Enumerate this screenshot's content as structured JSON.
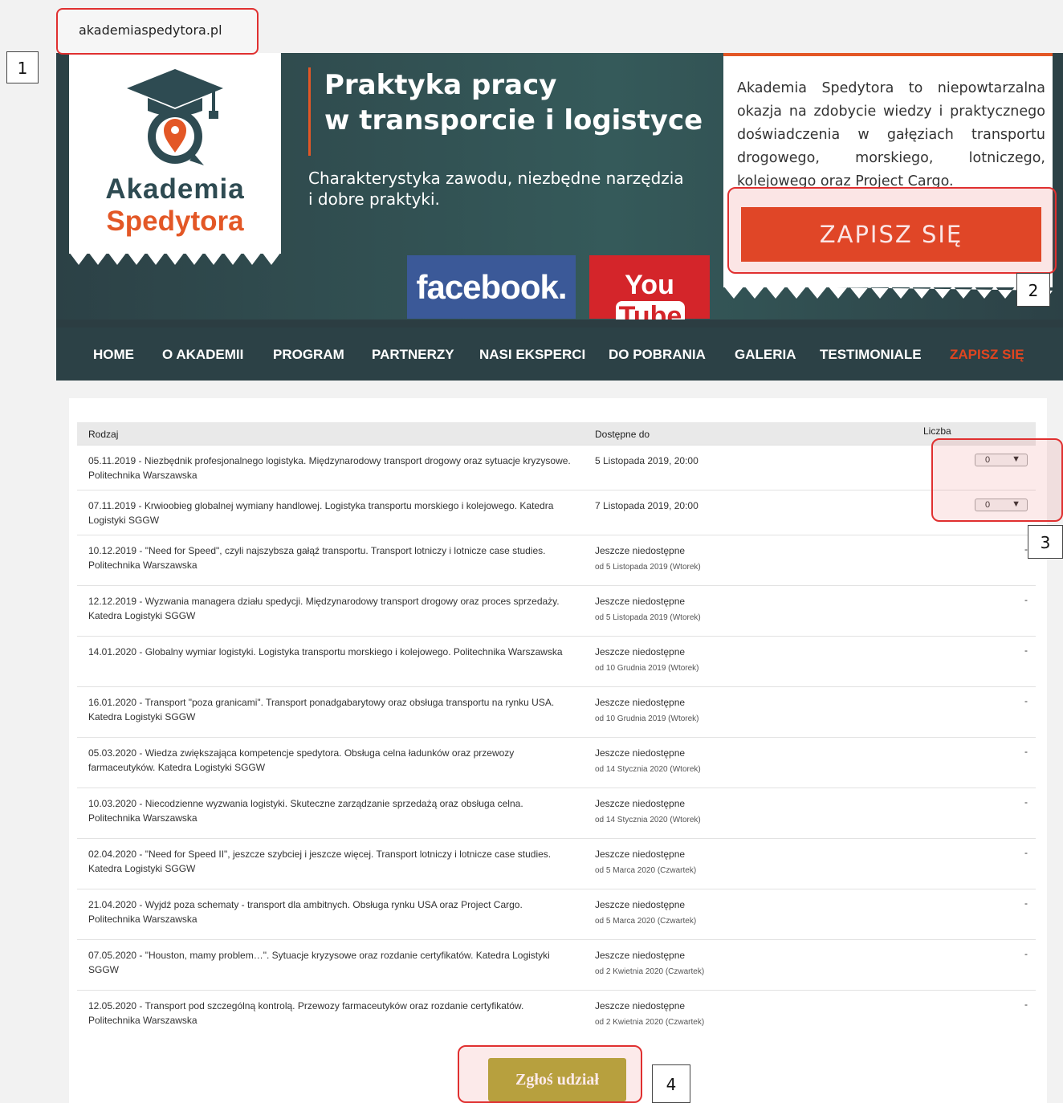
{
  "browser": {
    "url": "akademiaspedytora.pl"
  },
  "callouts": [
    "1",
    "2",
    "3",
    "4"
  ],
  "header": {
    "logo": {
      "line1": "Akademia",
      "line2": "Spedytora"
    },
    "title_line1": "Praktyka pracy",
    "title_line2": "w transporcie i logistyce",
    "subtitle_line1": "Charakterystyka zawodu, niezbędne narzędzia",
    "subtitle_line2": "i dobre praktyki.",
    "facebook_label": "facebook.",
    "youtube_you": "You",
    "youtube_tube": "Tube",
    "info_text": "Akademia Spedytora to niepowtarzalna okazja na zdobycie wiedzy i praktycznego doświadczenia w gałęziach transportu drogowego, morskiego, lotniczego, kolejowego oraz Project Cargo.",
    "signup_label": "ZAPISZ SIĘ",
    "colors": {
      "accent": "#e04520",
      "dark": "#2c4146",
      "facebook": "#3b5998",
      "youtube": "#d4252a",
      "submit": "#b1ab3c"
    }
  },
  "nav": {
    "items": [
      {
        "label": "HOME"
      },
      {
        "label": "O AKADEMII"
      },
      {
        "label": "PROGRAM"
      },
      {
        "label": "PARTNERZY"
      },
      {
        "label": "NASI EKSPERCI"
      },
      {
        "label": "DO POBRANIA"
      },
      {
        "label": "GALERIA"
      },
      {
        "label": "TESTIMONIALE"
      },
      {
        "label": "ZAPISZ SIĘ",
        "active": true
      }
    ]
  },
  "table": {
    "headers": {
      "type": "Rodzaj",
      "available": "Dostępne do",
      "qty": "Liczba"
    },
    "rows": [
      {
        "type": "05.11.2019 - Niezbędnik profesjonalnego logistyka. Międzynarodowy transport drogowy oraz sytuacje kryzysowe. Politechnika Warszawska",
        "available": "5 Listopada 2019, 20:00",
        "qty": "0"
      },
      {
        "type": "07.11.2019 - Krwioobieg globalnej wymiany handlowej. Logistyka transportu morskiego i kolejowego. Katedra Logistyki SGGW",
        "available": "7 Listopada 2019, 20:00",
        "qty": "0"
      },
      {
        "type": "10.12.2019 - \"Need for Speed\", czyli najszybsza gałąź transportu. Transport lotniczy i lotnicze case studies. Politechnika Warszawska",
        "available": "Jeszcze niedostępne",
        "from": "od 5 Listopada 2019 (Wtorek)",
        "qty": "-"
      },
      {
        "type": "12.12.2019 - Wyzwania managera działu spedycji. Międzynarodowy transport drogowy oraz proces sprzedaży. Katedra Logistyki SGGW",
        "available": "Jeszcze niedostępne",
        "from": "od 5 Listopada 2019 (Wtorek)",
        "qty": "-"
      },
      {
        "type": "14.01.2020 - Globalny wymiar logistyki. Logistyka transportu morskiego i kolejowego. Politechnika Warszawska",
        "available": "Jeszcze niedostępne",
        "from": "od 10 Grudnia 2019 (Wtorek)",
        "qty": "-"
      },
      {
        "type": "16.01.2020 - Transport \"poza granicami\". Transport ponadgabarytowy oraz obsługa transportu na rynku USA. Katedra Logistyki SGGW",
        "available": "Jeszcze niedostępne",
        "from": "od 10 Grudnia 2019 (Wtorek)",
        "qty": "-"
      },
      {
        "type": "05.03.2020 - Wiedza zwiększająca kompetencje spedytora. Obsługa celna ładunków oraz przewozy farmaceutyków. Katedra Logistyki SGGW",
        "available": "Jeszcze niedostępne",
        "from": "od 14 Stycznia 2020 (Wtorek)",
        "qty": "-"
      },
      {
        "type": "10.03.2020 - Niecodzienne wyzwania logistyki. Skuteczne zarządzanie sprzedażą oraz obsługa celna. Politechnika Warszawska",
        "available": "Jeszcze niedostępne",
        "from": "od 14 Stycznia 2020 (Wtorek)",
        "qty": "-"
      },
      {
        "type": "02.04.2020 - \"Need for Speed II\", jeszcze szybciej i jeszcze więcej. Transport lotniczy i lotnicze case studies. Katedra Logistyki SGGW",
        "available": "Jeszcze niedostępne",
        "from": "od 5 Marca 2020 (Czwartek)",
        "qty": "-"
      },
      {
        "type": "21.04.2020 - Wyjdź poza schematy - transport dla ambitnych. Obsługa rynku USA oraz Project Cargo. Politechnika Warszawska",
        "available": "Jeszcze niedostępne",
        "from": "od 5 Marca 2020 (Czwartek)",
        "qty": "-"
      },
      {
        "type": "07.05.2020 - \"Houston, mamy problem…\". Sytuacje kryzysowe oraz rozdanie certyfikatów. Katedra Logistyki SGGW",
        "available": "Jeszcze niedostępne",
        "from": "od 2 Kwietnia 2020 (Czwartek)",
        "qty": "-"
      },
      {
        "type": "12.05.2020 - Transport pod szczególną kontrolą. Przewozy farmaceutyków oraz rozdanie certyfikatów. Politechnika Warszawska",
        "available": "Jeszcze niedostępne",
        "from": "od 2 Kwietnia 2020 (Czwartek)",
        "qty": "-"
      }
    ]
  },
  "submit_label": "Zgłoś udział"
}
